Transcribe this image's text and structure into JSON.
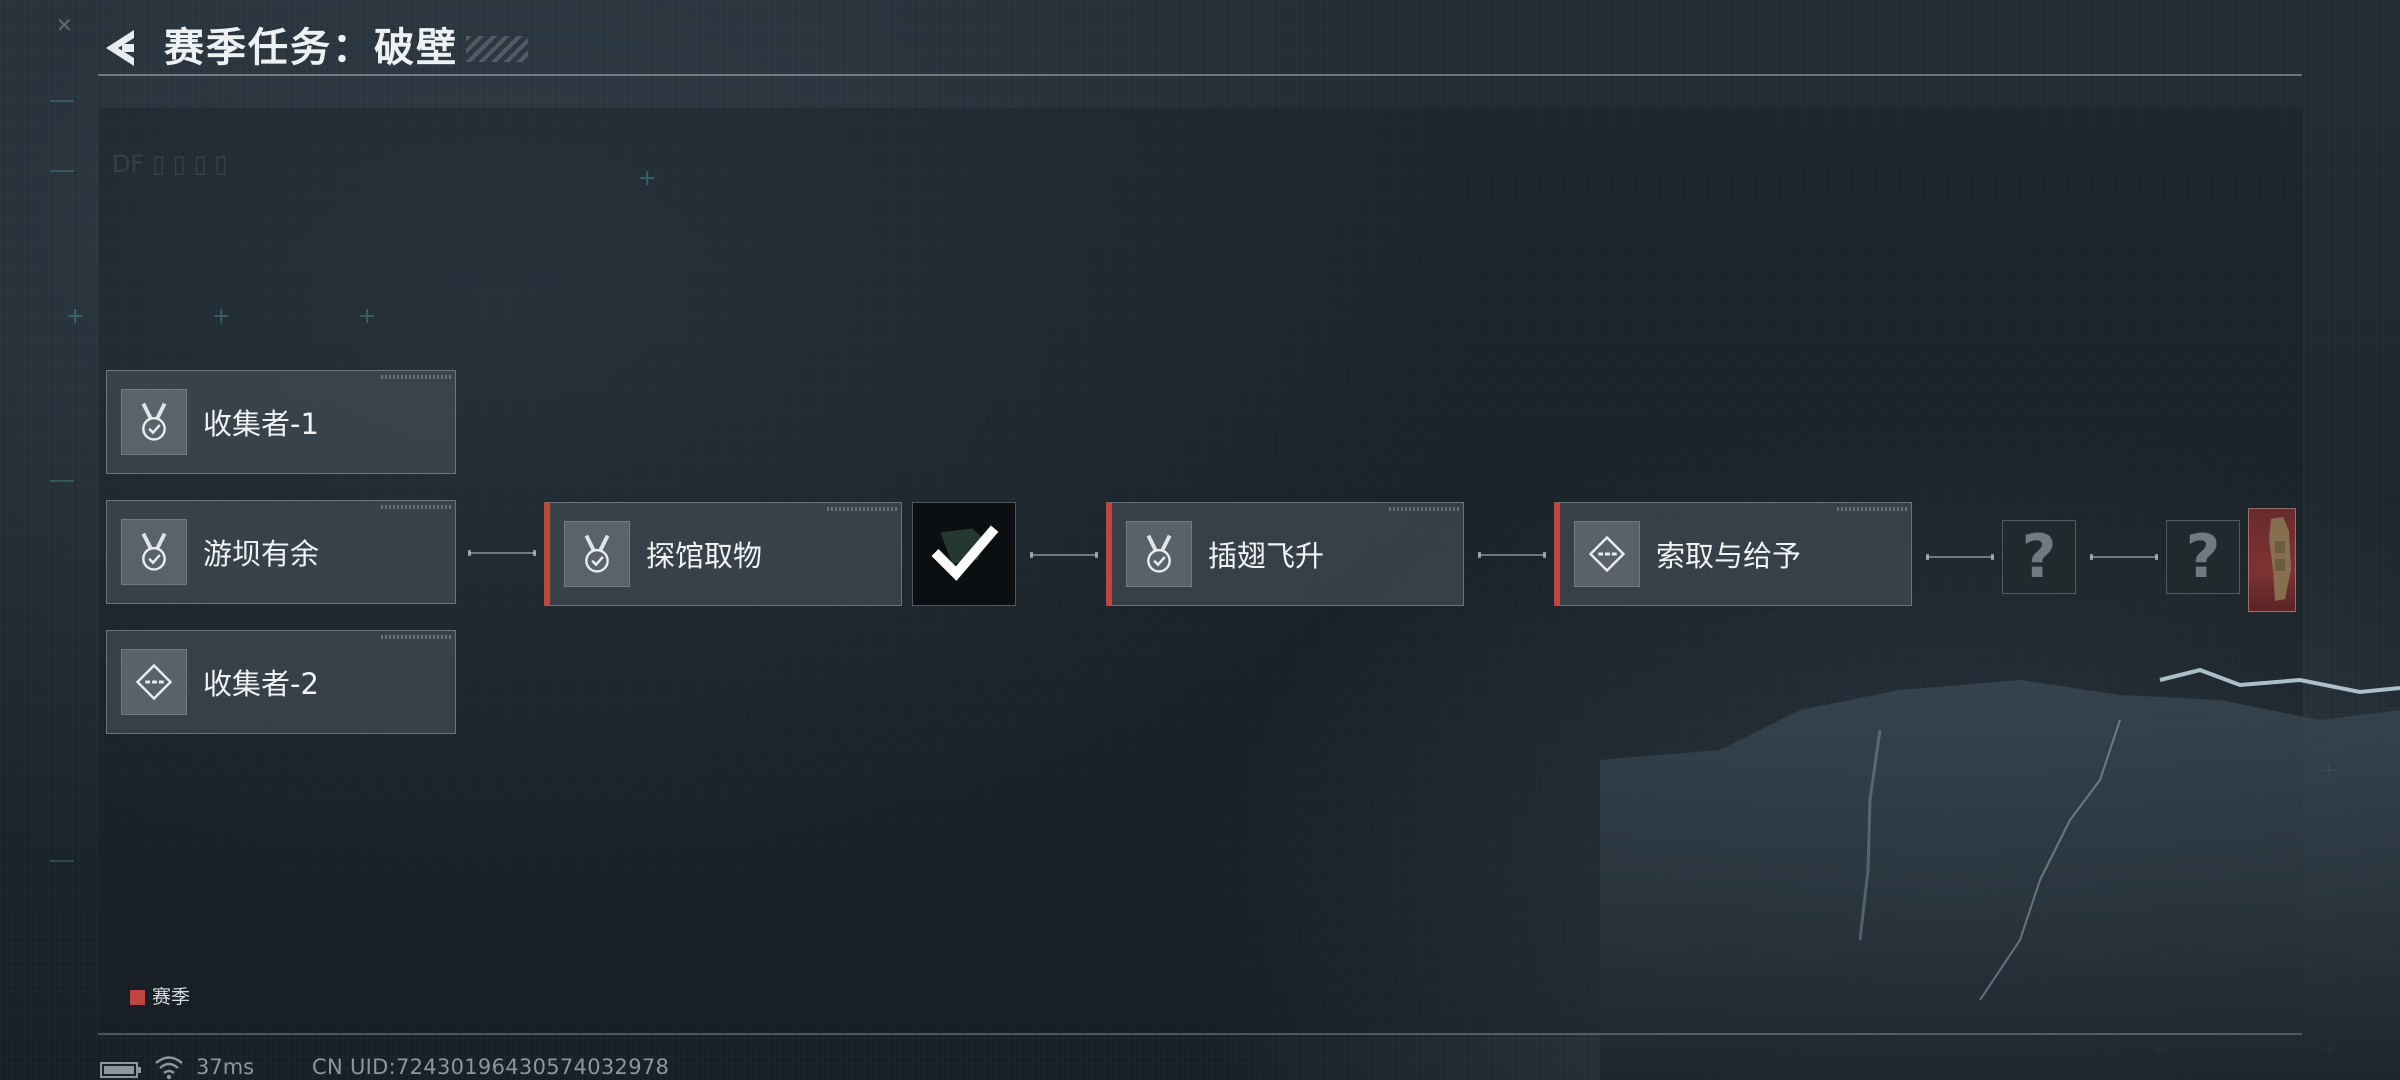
{
  "header": {
    "title": "赛季任务：破壁"
  },
  "tasks": {
    "collector_1": {
      "label": "收集者-1",
      "icon": "medal-check-icon",
      "season": false
    },
    "dam_surplus": {
      "label": "游坝有余",
      "icon": "medal-check-icon",
      "season": false
    },
    "collector_2": {
      "label": "收集者-2",
      "icon": "diamond-dash-icon",
      "season": false
    },
    "explore_take": {
      "label": "探馆取物",
      "icon": "medal-check-icon",
      "season": true,
      "completed": true
    },
    "take_flight": {
      "label": "插翅飞升",
      "icon": "medal-check-icon",
      "season": true
    },
    "take_give": {
      "label": "索取与给予",
      "icon": "diamond-dash-icon",
      "season": true
    }
  },
  "locked": {
    "first": "?",
    "second": "?"
  },
  "legend": {
    "season_label": "赛季",
    "season_color": "#c0453b"
  },
  "status": {
    "ping": "37ms",
    "uid": "CN UID:724301964305740329​78"
  },
  "colors": {
    "accent_red": "#c0453b",
    "background": "#1e262d"
  }
}
